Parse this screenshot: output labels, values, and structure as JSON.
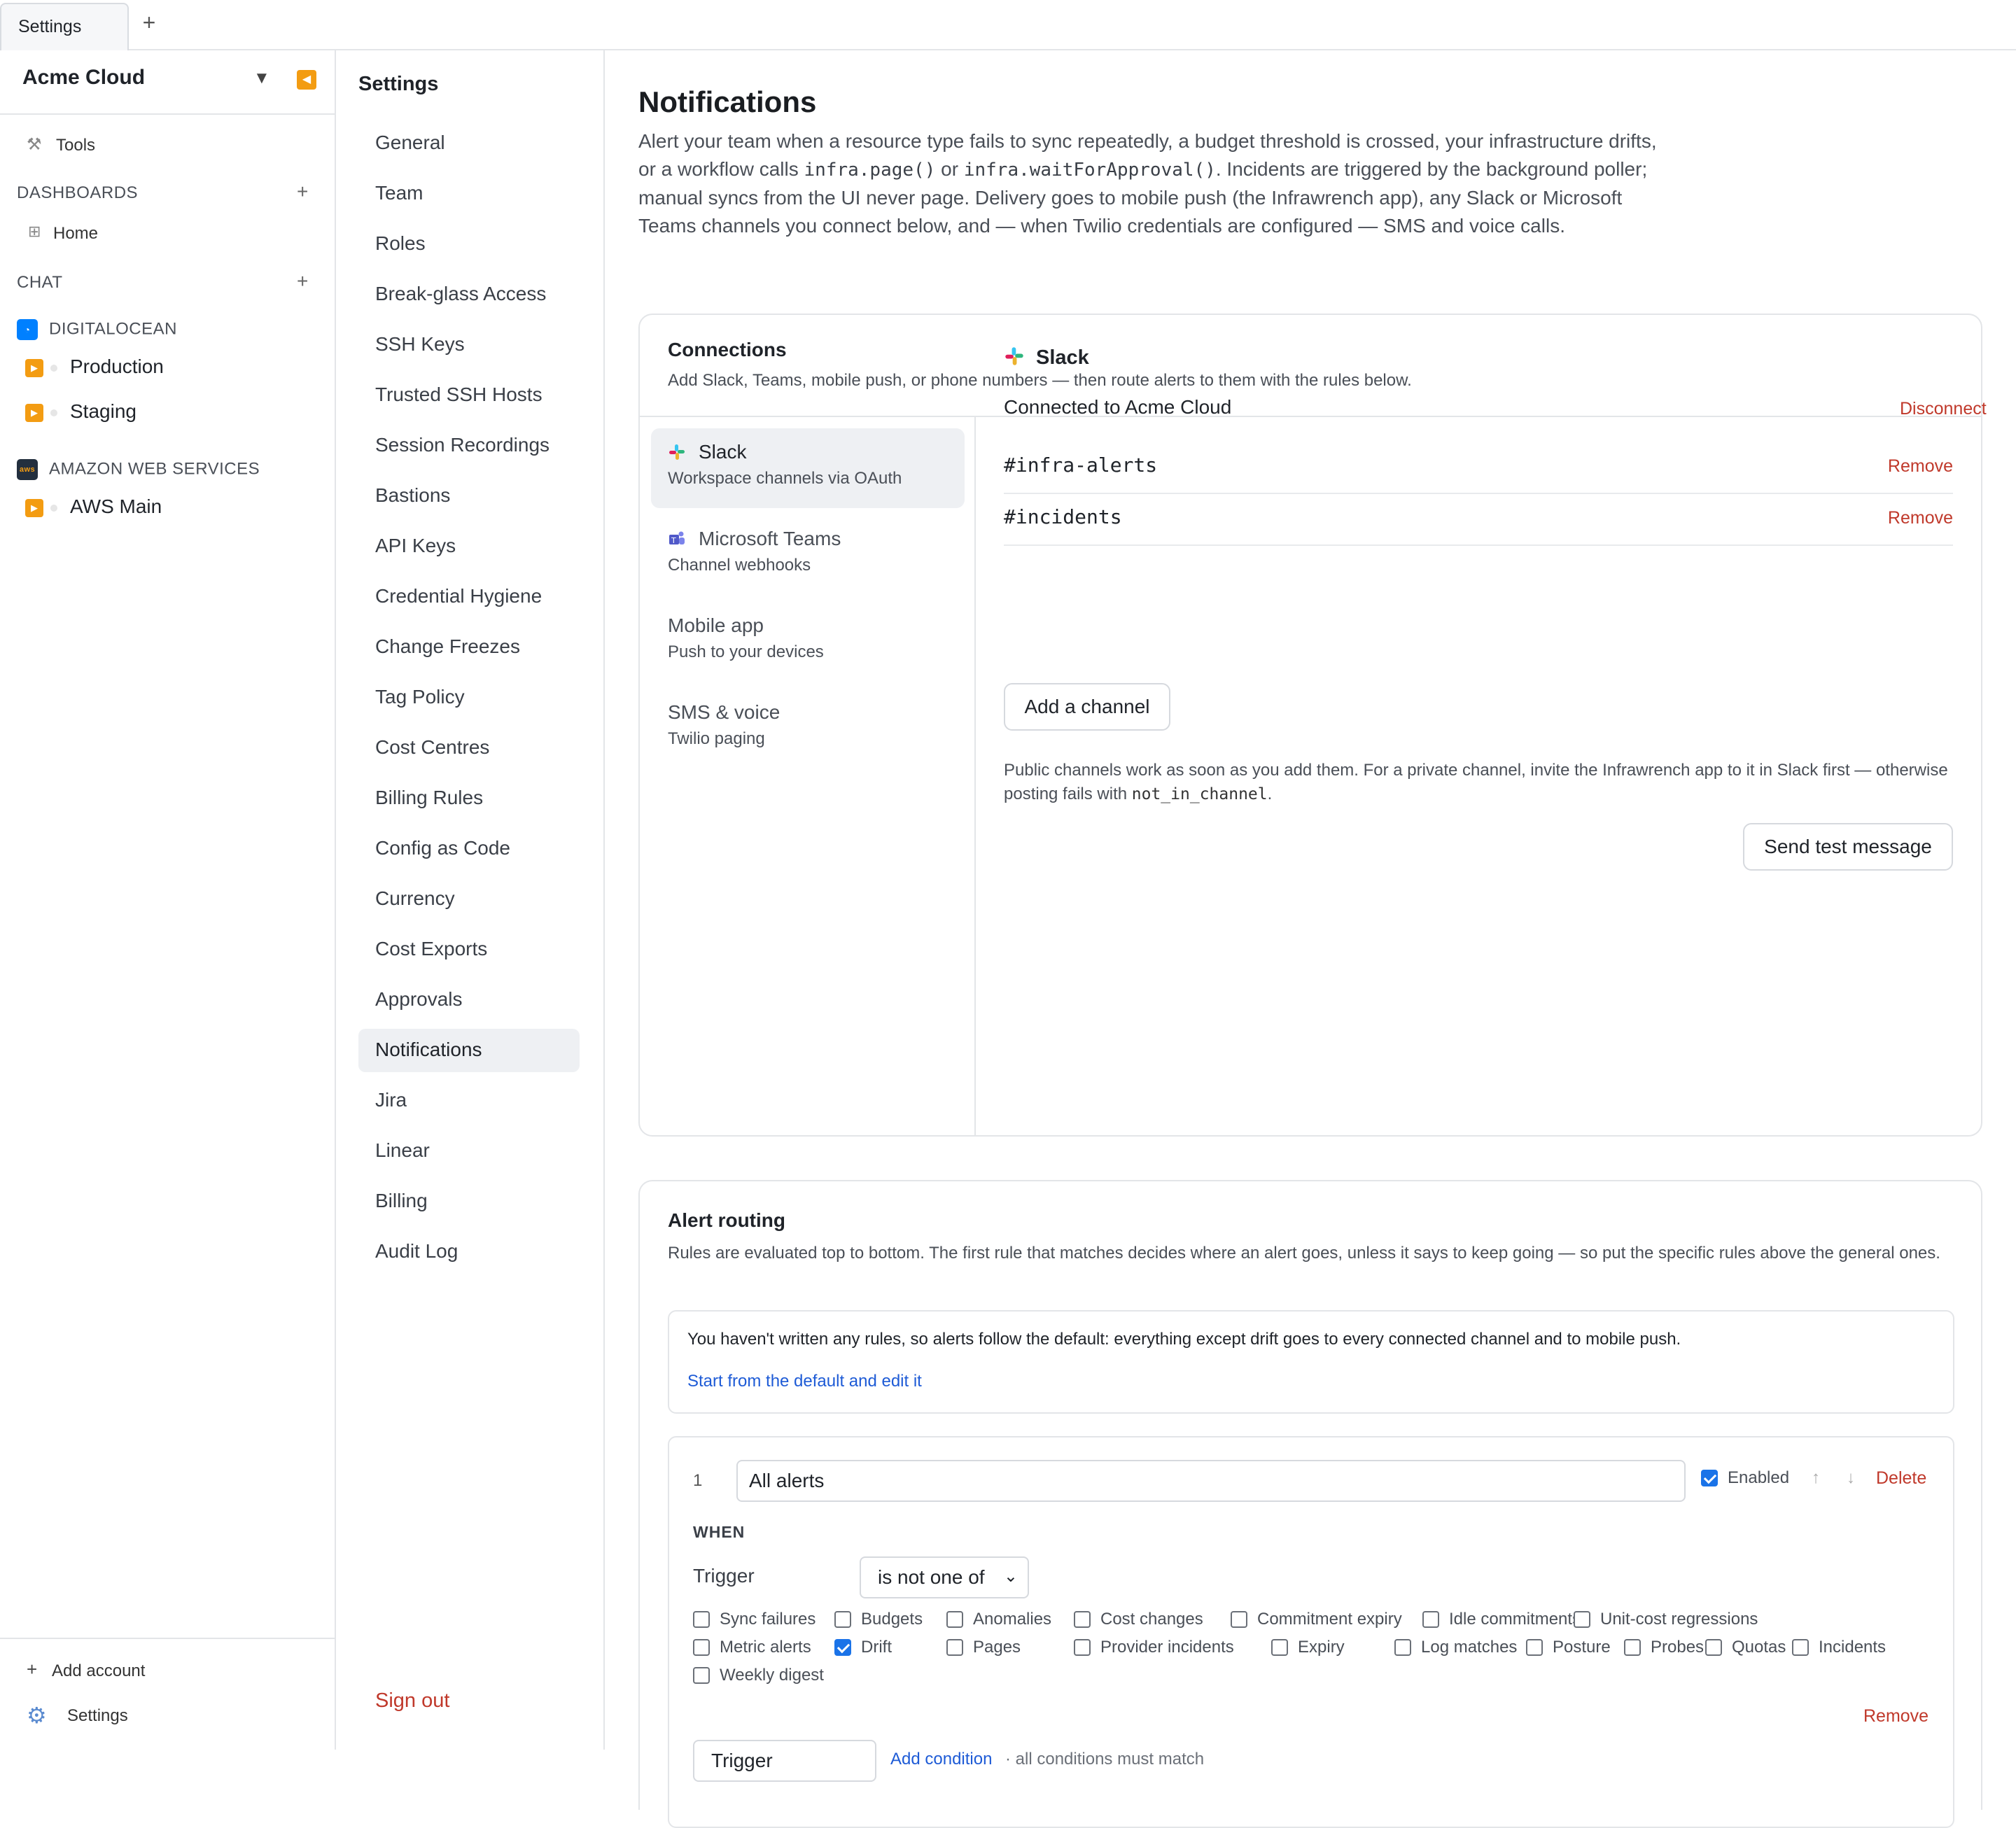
{
  "tabs": {
    "active_label": "Settings",
    "add_label": "+"
  },
  "sidebar": {
    "account": "Acme Cloud",
    "caret": "▼",
    "collapse": "◀",
    "tools": "Tools",
    "dashboards": {
      "title": "DASHBOARDS",
      "add": "+",
      "items": [
        "Home"
      ]
    },
    "chat": {
      "title": "CHAT",
      "add": "+"
    },
    "providers": [
      {
        "name": "DIGITALOCEAN",
        "color": "#0080ff",
        "envs": [
          "Production",
          "Staging"
        ]
      },
      {
        "name": "AMAZON WEB SERVICES",
        "color": "#232f3e",
        "logo_text": "aws",
        "envs": [
          "AWS Main"
        ]
      }
    ],
    "add_account": "Add account",
    "settings": "Settings"
  },
  "settings_nav": {
    "title": "Settings",
    "items": [
      "General",
      "Team",
      "Roles",
      "Break-glass Access",
      "SSH Keys",
      "Trusted SSH Hosts",
      "Session Recordings",
      "Bastions",
      "API Keys",
      "Credential Hygiene",
      "Change Freezes",
      "Tag Policy",
      "Cost Centres",
      "Billing Rules",
      "Config as Code",
      "Currency",
      "Cost Exports",
      "Approvals",
      "Notifications",
      "Jira",
      "Linear",
      "Billing",
      "Audit Log"
    ],
    "active": "Notifications",
    "sign_out": "Sign out"
  },
  "page": {
    "title": "Notifications",
    "intro_1": "Alert your team when a resource type fails to sync repeatedly, a budget threshold is crossed, your infrastructure drifts, or a workflow calls ",
    "intro_code_1": "infra.page()",
    "intro_2": " or ",
    "intro_code_2": "infra.waitForApproval()",
    "intro_3": ". Incidents are triggered by the background poller; manual syncs from the UI never page. Delivery goes to mobile push (the Infrawrench app), any Slack or Microsoft Teams channels you connect below, and — when Twilio credentials are configured — SMS and voice calls."
  },
  "connections": {
    "title": "Connections",
    "subtitle": "Add Slack, Teams, mobile push, or phone numbers — then route alerts to them with the rules below.",
    "providers": [
      {
        "name": "Slack",
        "desc": "Workspace channels via OAuth"
      },
      {
        "name": "Microsoft Teams",
        "desc": "Channel webhooks"
      },
      {
        "name": "Mobile app",
        "desc": "Push to your devices"
      },
      {
        "name": "SMS & voice",
        "desc": "Twilio paging"
      }
    ],
    "detail": {
      "title": "Slack",
      "connected": "Connected to Acme Cloud",
      "disconnect": "Disconnect",
      "channels": [
        "#infra-alerts",
        "#incidents"
      ],
      "remove": "Remove",
      "add_channel": "Add a channel",
      "note_1": "Public channels work as soon as you add them. For a private channel, invite the Infrawrench app to it in Slack first — otherwise posting fails with ",
      "note_code": "not_in_channel",
      "note_2": ".",
      "send_test": "Send test message"
    }
  },
  "routing": {
    "title": "Alert routing",
    "subtitle": "Rules are evaluated top to bottom. The first rule that matches decides where an alert goes, unless it says to keep going — so put the specific rules above the general ones.",
    "default_text": "You haven't written any rules, so alerts follow the default: everything except drift goes to every connected channel and to mobile push.",
    "default_link": "Start from the default and edit it",
    "rule": {
      "number": "1",
      "name": "All alerts",
      "enabled_label": "Enabled",
      "enabled": true,
      "up": "↑",
      "down": "↓",
      "delete": "Delete",
      "when": "WHEN",
      "trigger_label": "Trigger",
      "trigger_op": "is not one of",
      "options_row1": [
        "Sync failures",
        "Budgets",
        "Anomalies",
        "Cost changes",
        "Commitment expiry",
        "Idle commitments",
        "Unit-cost regressions"
      ],
      "options_row2": [
        "Metric alerts",
        "Drift",
        "Pages",
        "Provider incidents",
        "Expiry",
        "Log matches",
        "Posture",
        "Probes",
        "Quotas",
        "Incidents"
      ],
      "options_row3": [
        "Weekly digest"
      ],
      "checked": [
        "Drift"
      ],
      "remove": "Remove",
      "trigger2": "Trigger",
      "add_condition": "Add condition",
      "all_conditions": "· all conditions must match"
    }
  },
  "colors": {
    "accent": "#1a73e8",
    "danger": "#c0392b",
    "link": "#1e5bd6",
    "warning": "#f39c12"
  }
}
